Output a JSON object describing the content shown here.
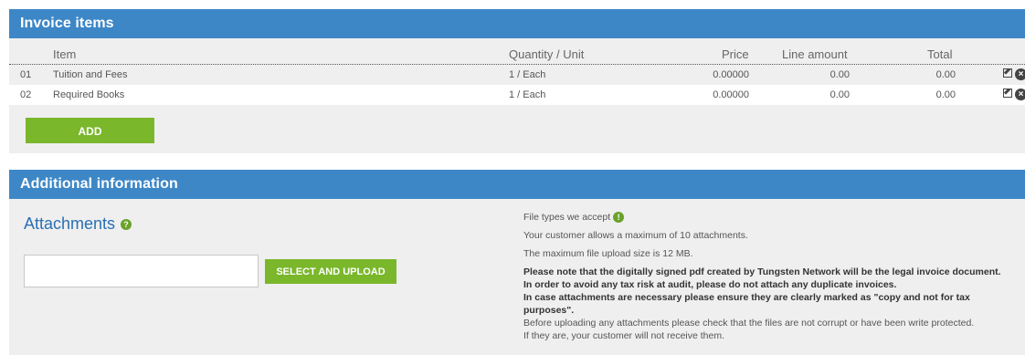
{
  "invoice_items": {
    "header": "Invoice items",
    "columns": {
      "item": "Item",
      "quantity_unit": "Quantity / Unit",
      "price": "Price",
      "line_amount": "Line amount",
      "total": "Total"
    },
    "rows": [
      {
        "num": "01",
        "item": "Tuition and Fees",
        "qty": "1 / Each",
        "price": "0.00000",
        "line_amount": "0.00",
        "total": "0.00"
      },
      {
        "num": "02",
        "item": "Required Books",
        "qty": "1 / Each",
        "price": "0.00000",
        "line_amount": "0.00",
        "total": "0.00"
      }
    ],
    "add_label": "ADD"
  },
  "additional_info": {
    "header": "Additional information",
    "attachments_title": "Attachments",
    "help_icon": "question-icon",
    "upload_label": "SELECT AND UPLOAD",
    "file_input_value": "",
    "file_types": "File types we accept",
    "info_icon": "info-icon",
    "max_attachments": "Your customer allows a maximum of 10 attachments.",
    "max_size": "The maximum file upload size is 12 MB.",
    "note_legal": "Please note that the digitally signed pdf created by Tungsten Network will be the legal invoice document.",
    "note_duplicate": "In order to avoid any tax risk at audit, please do not attach any duplicate invoices.",
    "note_copy": "In case attachments are necessary please ensure they are clearly marked as \"copy and not for tax purposes\".",
    "note_corrupt": "Before uploading any attachments please check that the files are not corrupt or have been write protected.",
    "note_receive": "If they are, your customer will not receive them."
  },
  "colors": {
    "header_bg": "#3d87c7",
    "button_green": "#7ab72b",
    "panel_bg": "#efefef",
    "title_blue": "#2a6fb5"
  }
}
